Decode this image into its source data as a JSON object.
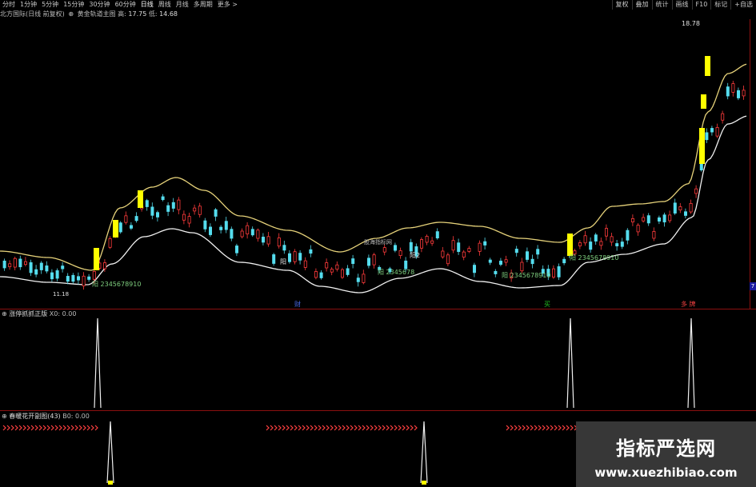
{
  "toolbar": {
    "periods": [
      "分时",
      "1分钟",
      "5分钟",
      "15分钟",
      "30分钟",
      "60分钟",
      "日线",
      "周线",
      "月线",
      "多周期",
      "更多 >"
    ],
    "active": "日线",
    "right_buttons": [
      "复权",
      "叠加",
      "统计",
      "画线",
      "F10",
      "标记",
      "+自选"
    ]
  },
  "stock": {
    "name": "北方国际(日线 前复权)",
    "indicator": "黄金轨道主图",
    "hi_label": "高:",
    "hi_value": "17.75",
    "lo_label": "低:",
    "lo_value": "14.68"
  },
  "main_chart": {
    "price_high_label": "18.78",
    "price_low_label": "11.18",
    "annotations": [
      {
        "text": "阳 2345678910",
        "color": "#7fcf7f"
      },
      {
        "text": "阳 2345678",
        "color": "#7fcf7f"
      },
      {
        "text": "阳 2345678910",
        "color": "#7fcf7f"
      },
      {
        "text": "阳 2345678910",
        "color": "#7fcf7f"
      },
      {
        "text": "阳",
        "color": "#e0e0e0"
      },
      {
        "text": "阳2",
        "color": "#e0e0e0"
      }
    ],
    "watermark_text": "股海指标网",
    "bottom_markers": [
      {
        "text": "财",
        "color": "#4a6cf0"
      },
      {
        "text": "买",
        "color": "#20c020"
      },
      {
        "text": "多 牌",
        "color": "#f04040"
      }
    ],
    "axis_mark": "7",
    "colors": {
      "up": "#ff3b3b",
      "down": "#55ddee",
      "band": "#e6d27a",
      "band_low": "#f0f0f0",
      "signal": "#ffff00"
    }
  },
  "panel2": {
    "title": "涨停抓抓正版",
    "x0_label": "X0:",
    "x0_value": "0.00"
  },
  "panel3": {
    "title": "春暖花开副图(43)",
    "b0_label": "B0:",
    "b0_value": "0.00"
  },
  "watermark": {
    "line1": "指标严选网",
    "line2": "www.xuezhibiao.com"
  }
}
